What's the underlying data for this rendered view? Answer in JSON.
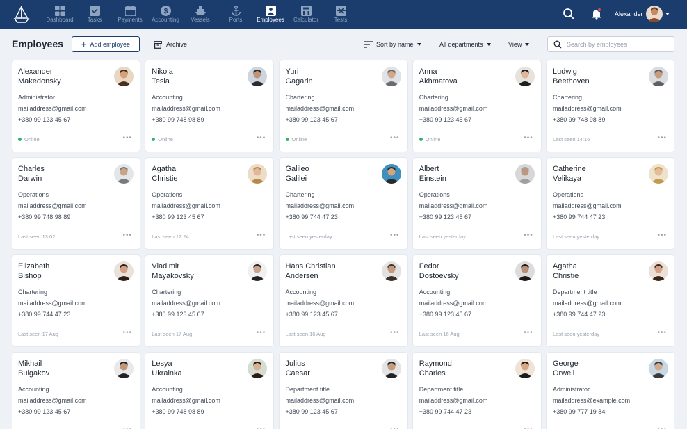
{
  "nav": {
    "items": [
      {
        "label": "Dashboard",
        "icon": "dashboard-icon"
      },
      {
        "label": "Tasks",
        "icon": "tasks-icon"
      },
      {
        "label": "Payments",
        "icon": "payments-icon"
      },
      {
        "label": "Accounting",
        "icon": "accounting-icon"
      },
      {
        "label": "Vessels",
        "icon": "vessels-icon"
      },
      {
        "label": "Ports",
        "icon": "ports-icon"
      },
      {
        "label": "Employees",
        "icon": "employees-icon",
        "active": true
      },
      {
        "label": "Calculator",
        "icon": "calculator-icon"
      },
      {
        "label": "Tests",
        "icon": "tests-icon"
      }
    ],
    "user_name": "Alexander"
  },
  "toolbar": {
    "title": "Employees",
    "add_label": "Add employee",
    "archive_label": "Archive",
    "sort_label": "Sort by name",
    "departments_label": "All departments",
    "view_label": "View",
    "search_placeholder": "Search by employees"
  },
  "colors": {
    "nav_bg": "#1b3d6e",
    "online": "#2fb36b",
    "page_bg": "#eef1f5"
  },
  "employees": [
    {
      "first": "Alexander",
      "last": "Makedonsky",
      "dept": "Administrator",
      "email": "mailaddress@gmail.com",
      "phone": "+380 99 123 45 67",
      "status": "Online",
      "online": true
    },
    {
      "first": "Nikola",
      "last": "Tesla",
      "dept": "Accounting",
      "email": "mailaddress@gmail.com",
      "phone": "+380 99 748 98 89",
      "status": "Online",
      "online": true
    },
    {
      "first": "Yuri",
      "last": "Gagarin",
      "dept": "Chartering",
      "email": "mailaddress@gmail.com",
      "phone": "+380 99 123 45 67",
      "status": "Online",
      "online": true
    },
    {
      "first": "Anna",
      "last": "Akhmatova",
      "dept": "Chartering",
      "email": "mailaddress@gmail.com",
      "phone": "+380 99 123 45 67",
      "status": "Online",
      "online": true
    },
    {
      "first": "Ludwig",
      "last": "Beethoven",
      "dept": "Chartering",
      "email": "mailaddress@gmail.com",
      "phone": "+380 99 748 98 89",
      "status": "Last seen 14:16",
      "online": false
    },
    {
      "first": "Charles",
      "last": "Darwin",
      "dept": "Operations",
      "email": "mailaddress@gmail.com",
      "phone": "+380 99 748 98 89",
      "status": "Last seen 13:02",
      "online": false
    },
    {
      "first": "Agatha",
      "last": "Christie",
      "dept": "Operations",
      "email": "mailaddress@gmail.com",
      "phone": "+380 99 123 45 67",
      "status": "Last seen 12:24",
      "online": false
    },
    {
      "first": "Galileo",
      "last": "Galilei",
      "dept": "Chartering",
      "email": "mailaddress@gmail.com",
      "phone": "+380 99 744 47 23",
      "status": "Last seen yesterday",
      "online": false
    },
    {
      "first": "Albert",
      "last": "Einstein",
      "dept": "Operations",
      "email": "mailaddress@gmail.com",
      "phone": "+380 99 123 45 67",
      "status": "Last seen yesterday",
      "online": false
    },
    {
      "first": "Catherine",
      "last": "Velikaya",
      "dept": "Operations",
      "email": "mailaddress@gmail.com",
      "phone": "+380 99 744 47 23",
      "status": "Last seen yesterday",
      "online": false
    },
    {
      "first": "Elizabeth",
      "last": "Bishop",
      "dept": "Chartering",
      "email": "mailaddress@gmail.com",
      "phone": "+380 99 744 47 23",
      "status": "Last seen 17 Aug",
      "online": false
    },
    {
      "first": "Vladimir",
      "last": "Mayakovsky",
      "dept": "Chartering",
      "email": "mailaddress@gmail.com",
      "phone": "+380 99 123 45 67",
      "status": "Last seen 17 Aug",
      "online": false
    },
    {
      "first": "Hans Christian",
      "last": "Andersen",
      "dept": "Accounting",
      "email": "mailaddress@gmail.com",
      "phone": "+380 99 123 45 67",
      "status": "Last seen 16 Aug",
      "online": false
    },
    {
      "first": "Fedor",
      "last": "Dostoevsky",
      "dept": "Accounting",
      "email": "mailaddress@gmail.com",
      "phone": "+380 99 123 45 67",
      "status": "Last seen 16 Aug",
      "online": false
    },
    {
      "first": "Agatha",
      "last": "Christie",
      "dept": "Department title",
      "email": "mailaddress@gmail.com",
      "phone": "+380 99 744 47 23",
      "status": "Last seen yesterday",
      "online": false
    },
    {
      "first": "Mikhail",
      "last": "Bulgakov",
      "dept": "Accounting",
      "email": "mailaddress@gmail.com",
      "phone": "+380 99 123 45 67",
      "status": "",
      "online": false
    },
    {
      "first": "Lesya",
      "last": "Ukrainka",
      "dept": "Accounting",
      "email": "mailaddress@gmail.com",
      "phone": "+380 99 748 98 89",
      "status": "",
      "online": false
    },
    {
      "first": "Julius",
      "last": "Caesar",
      "dept": "Department title",
      "email": "mailaddress@gmail.com",
      "phone": "+380 99 123 45 67",
      "status": "",
      "online": false
    },
    {
      "first": "Raymond",
      "last": "Charles",
      "dept": "Department title",
      "email": "mailaddress@gmail.com",
      "phone": "+380 99 744 47 23",
      "status": "",
      "online": false
    },
    {
      "first": "George",
      "last": "Orwell",
      "dept": "Administrator",
      "email": "mailaddress@example.com",
      "phone": "+380 99 777 19 84",
      "status": "",
      "online": false
    }
  ]
}
